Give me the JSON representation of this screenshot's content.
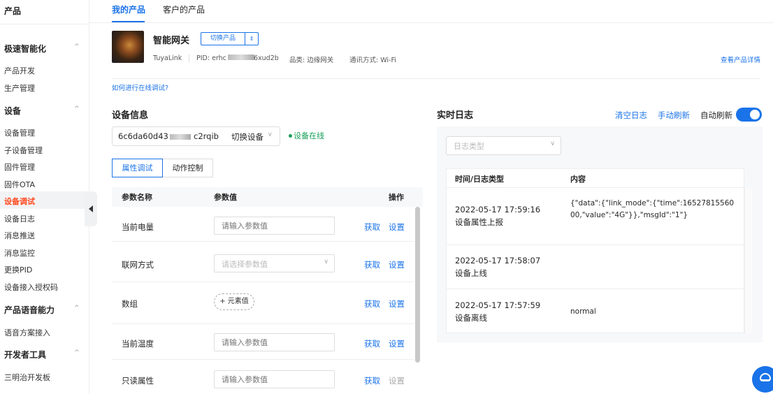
{
  "sidebar": {
    "title": "产品",
    "groups": [
      {
        "label": "极速智能化",
        "items": [
          "产品开发",
          "生产管理"
        ]
      },
      {
        "label": "设备",
        "items": [
          "设备管理",
          "子设备管理",
          "固件管理",
          "固件OTA",
          "设备调试",
          "设备日志",
          "消息推送",
          "消息监控",
          "更换PID",
          "设备接入授权码"
        ]
      },
      {
        "label": "产品语音能力",
        "items": [
          "语音方案接入"
        ]
      },
      {
        "label": "开发者工具",
        "items": [
          "三明治开发板"
        ]
      }
    ],
    "active_item": "设备调试",
    "chevron": "^"
  },
  "top_tabs": [
    "我的产品",
    "客户的产品"
  ],
  "product": {
    "name": "智能网关",
    "switch_label": "切换产品",
    "switch_icon": "⇕",
    "platform": "TuyaLink",
    "pid_prefix": "PID: erhc",
    "pid_suffix": "6xud2b",
    "category": "品类: 边缘网关",
    "comm": "通讯方式: Wi-Fi",
    "detail_link": "查看产品详情",
    "howto_link": "如何进行在线调试?"
  },
  "device_info": {
    "title": "设备信息",
    "id_prefix": "6c6da60d43",
    "id_suffix": "c2rqib",
    "switch_label": "切换设备",
    "switch_chevron": "∨",
    "status": "设备在线",
    "seg_tabs": [
      "属性调试",
      "动作控制"
    ]
  },
  "props_table": {
    "headers": {
      "name": "参数名称",
      "value": "参数值",
      "ops": "操作"
    },
    "rows": [
      {
        "name": "当前电量",
        "type": "input",
        "placeholder": "请输入参数值",
        "get": "获取",
        "set": "设置",
        "set_disabled": false
      },
      {
        "name": "联网方式",
        "type": "select",
        "placeholder": "请选择参数值",
        "get": "获取",
        "set": "设置",
        "set_disabled": false
      },
      {
        "name": "数组",
        "type": "array",
        "placeholder": "+ 元素值",
        "get": "获取",
        "set": "设置",
        "set_disabled": false
      },
      {
        "name": "当前温度",
        "type": "input",
        "placeholder": "请输入参数值",
        "get": "获取",
        "set": "设置",
        "set_disabled": false
      },
      {
        "name": "只读属性",
        "type": "input",
        "placeholder": "请输入参数值",
        "get": "获取",
        "set": "设置",
        "set_disabled": true
      }
    ]
  },
  "realtime_log": {
    "title": "实时日志",
    "clear": "清空日志",
    "manual_refresh": "手动刷新",
    "auto_refresh": "自动刷新",
    "auto_refresh_on": true,
    "filter_placeholder": "日志类型",
    "headers": {
      "time": "时间/日志类型",
      "content": "内容"
    },
    "rows": [
      {
        "time": "2022-05-17 17:59:16",
        "type": "设备属性上报",
        "content": "{\"data\":{\"link_mode\":{\"time\":1652781556000,\"value\":\"4G\"}},\"msgId\":\"1\"}"
      },
      {
        "time": "2022-05-17 17:58:07",
        "type": "设备上线",
        "content": ""
      },
      {
        "time": "2022-05-17 17:57:59",
        "type": "设备离线",
        "content": "normal"
      }
    ]
  },
  "colors": {
    "primary": "#1a73e8",
    "active_nav": "#ff4a1f",
    "online": "#18a058"
  }
}
